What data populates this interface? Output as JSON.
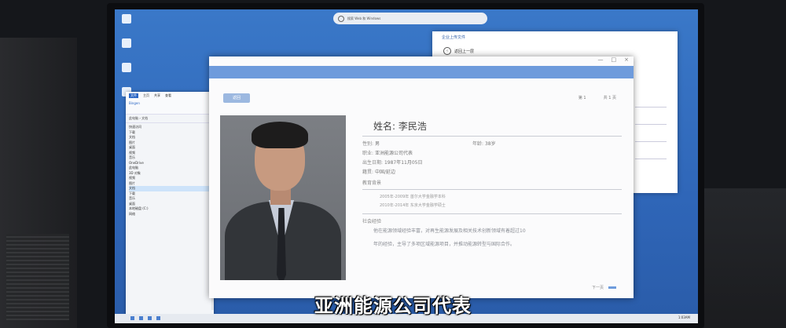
{
  "desktop": {
    "icons": [
      "",
      "",
      "",
      ""
    ],
    "search_placeholder": "搜索 Web 和 Windows"
  },
  "explorer": {
    "tabs": [
      "文件",
      "主页",
      "共享",
      "查看"
    ],
    "tools_label": "Bingen",
    "nav_path": "此电脑 › 文档",
    "tree": [
      "快速访问",
      "下载",
      "文档",
      "图片",
      "桌面",
      "视频",
      "音乐",
      "OneDrive",
      "此电脑",
      "3D 对象",
      "视频",
      "图片",
      "文档",
      "下载",
      "音乐",
      "桌面",
      "本地磁盘 (C:)",
      "网络"
    ],
    "selected_index": 12
  },
  "back_window": {
    "title": "企业上传文件",
    "return_label": "返回上一层"
  },
  "profile": {
    "window_controls": [
      "—",
      "□",
      "×"
    ],
    "back_button": "返回",
    "pager_left": "第 1",
    "pager_right": "共 1 页",
    "name_label": "姓名:",
    "name_value": "李民浩",
    "gender_label": "性别:",
    "gender_value": "男",
    "age_label": "年龄:",
    "age_value": "38岁",
    "job_label": "职业:",
    "job_value": "亚洲能源公司代表",
    "birth_label": "出生日期:",
    "birth_value": "1987年11月05日",
    "native_label": "籍贯:",
    "native_value": "中国/延边",
    "edu_title": "教育背景",
    "edu_items": [
      "2005年-2009年  首尔大学金融学本科",
      "2010年-2014年  东京大学金融学硕士"
    ],
    "work_title": "社会经验",
    "desc_lines": [
      "他在能源领域经验丰富，对再生能源发展及相关技术创新领域有着超过10",
      "年的经验，主导了多项区域能源项目，并推动能源转型与国际合作。"
    ],
    "next_label": "下一页"
  },
  "taskbar": {
    "clock": "1:03AM"
  },
  "subtitle": "亚洲能源公司代表"
}
